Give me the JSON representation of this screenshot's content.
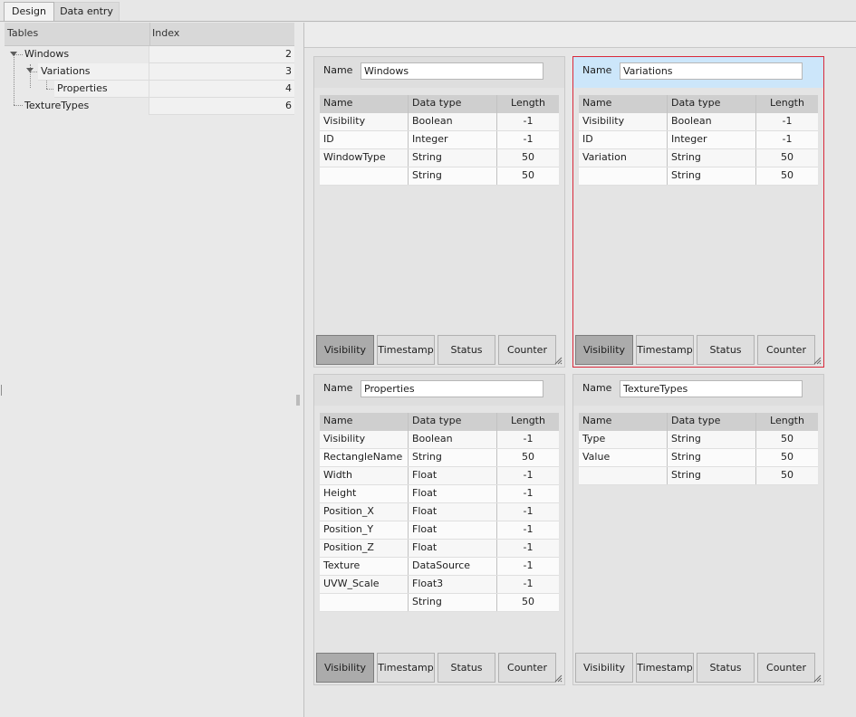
{
  "tabs": [
    {
      "label": "Design",
      "active": true
    },
    {
      "label": "Data entry",
      "active": false
    }
  ],
  "tree": {
    "headers": {
      "tables": "Tables",
      "index": "Index"
    },
    "rows": [
      {
        "label": "Windows",
        "index": "2",
        "level": 0
      },
      {
        "label": "Variations",
        "index": "3",
        "level": 1
      },
      {
        "label": "Properties",
        "index": "4",
        "level": 2
      },
      {
        "label": "TextureTypes",
        "index": "6",
        "level": 0
      }
    ]
  },
  "grid_headers": {
    "name": "Name",
    "type": "Data type",
    "length": "Length"
  },
  "name_label": "Name",
  "buttons": {
    "visibility": "Visibility",
    "timestamp": "Timestamp",
    "status": "Status",
    "counter": "Counter"
  },
  "cards": [
    {
      "title": "Windows",
      "selected": false,
      "visibility_on": true,
      "rows": [
        [
          "Visibility",
          "Boolean",
          "-1"
        ],
        [
          "ID",
          "Integer",
          "-1"
        ],
        [
          "WindowType",
          "String",
          "50"
        ],
        [
          "",
          "String",
          "50"
        ]
      ]
    },
    {
      "title": "Variations",
      "selected": true,
      "visibility_on": true,
      "rows": [
        [
          "Visibility",
          "Boolean",
          "-1"
        ],
        [
          "ID",
          "Integer",
          "-1"
        ],
        [
          "Variation",
          "String",
          "50"
        ],
        [
          "",
          "String",
          "50"
        ]
      ]
    },
    {
      "title": "Properties",
      "selected": false,
      "visibility_on": true,
      "rows": [
        [
          "Visibility",
          "Boolean",
          "-1"
        ],
        [
          "RectangleName",
          "String",
          "50"
        ],
        [
          "Width",
          "Float",
          "-1"
        ],
        [
          "Height",
          "Float",
          "-1"
        ],
        [
          "Position_X",
          "Float",
          "-1"
        ],
        [
          "Position_Y",
          "Float",
          "-1"
        ],
        [
          "Position_Z",
          "Float",
          "-1"
        ],
        [
          "Texture",
          "DataSource",
          "-1"
        ],
        [
          "UVW_Scale",
          "Float3",
          "-1"
        ],
        [
          "",
          "String",
          "50"
        ]
      ]
    },
    {
      "title": "TextureTypes",
      "selected": false,
      "visibility_on": false,
      "rows": [
        [
          "Type",
          "String",
          "50"
        ],
        [
          "Value",
          "String",
          "50"
        ],
        [
          "",
          "String",
          "50"
        ]
      ]
    }
  ],
  "colors": {
    "selection_border": "#d9293b",
    "selection_header": "#cce6fa",
    "pressed_button": "#ababab"
  }
}
